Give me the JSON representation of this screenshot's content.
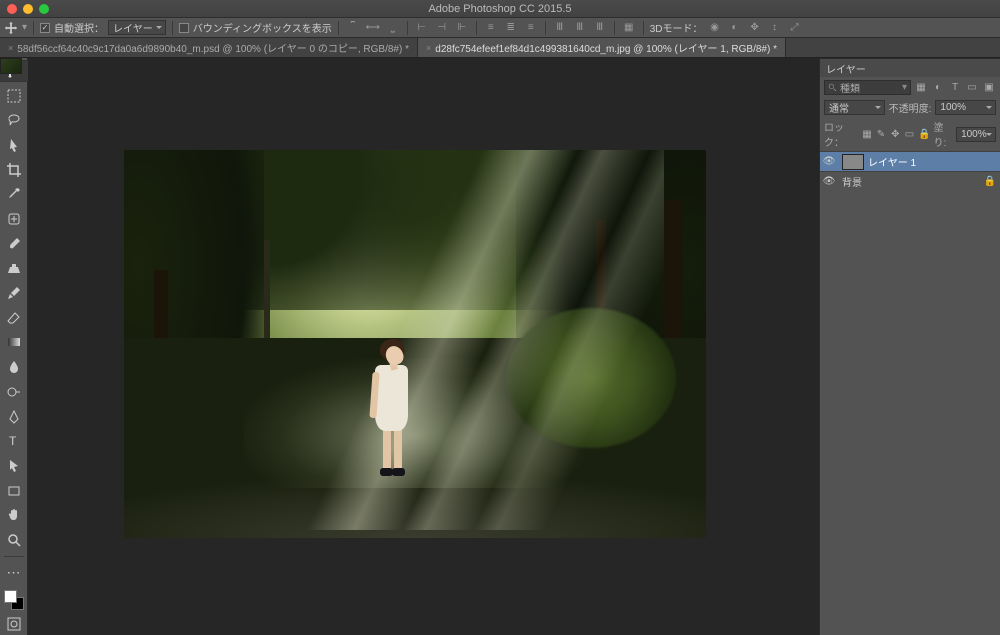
{
  "app": {
    "title": "Adobe Photoshop CC 2015.5"
  },
  "options": {
    "auto_select_label": "自動選択：",
    "layer_dropdown": "レイヤー",
    "show_bbox_label": "バウンディングボックスを表示",
    "mode3d": "3Dモード："
  },
  "tabs": [
    {
      "label": "58df56ccf64c40c9c17da0a6d9890b40_m.psd @ 100% (レイヤー 0 のコピー, RGB/8#) *",
      "active": false
    },
    {
      "label": "d28fc754efeef1ef84d1c499381640cd_m.jpg @ 100% (レイヤー 1, RGB/8#) *",
      "active": true
    }
  ],
  "layers_panel": {
    "title": "レイヤー",
    "search_placeholder": "種類",
    "blend_mode": "通常",
    "opacity_label": "不透明度:",
    "opacity_value": "100%",
    "lock_label": "ロック：",
    "fill_label": "塗り:",
    "fill_value": "100%",
    "items": [
      {
        "name": "レイヤー 1",
        "visible": true,
        "active": true,
        "thumb": "layer"
      },
      {
        "name": "背景",
        "visible": true,
        "active": false,
        "thumb": "forest"
      }
    ]
  }
}
